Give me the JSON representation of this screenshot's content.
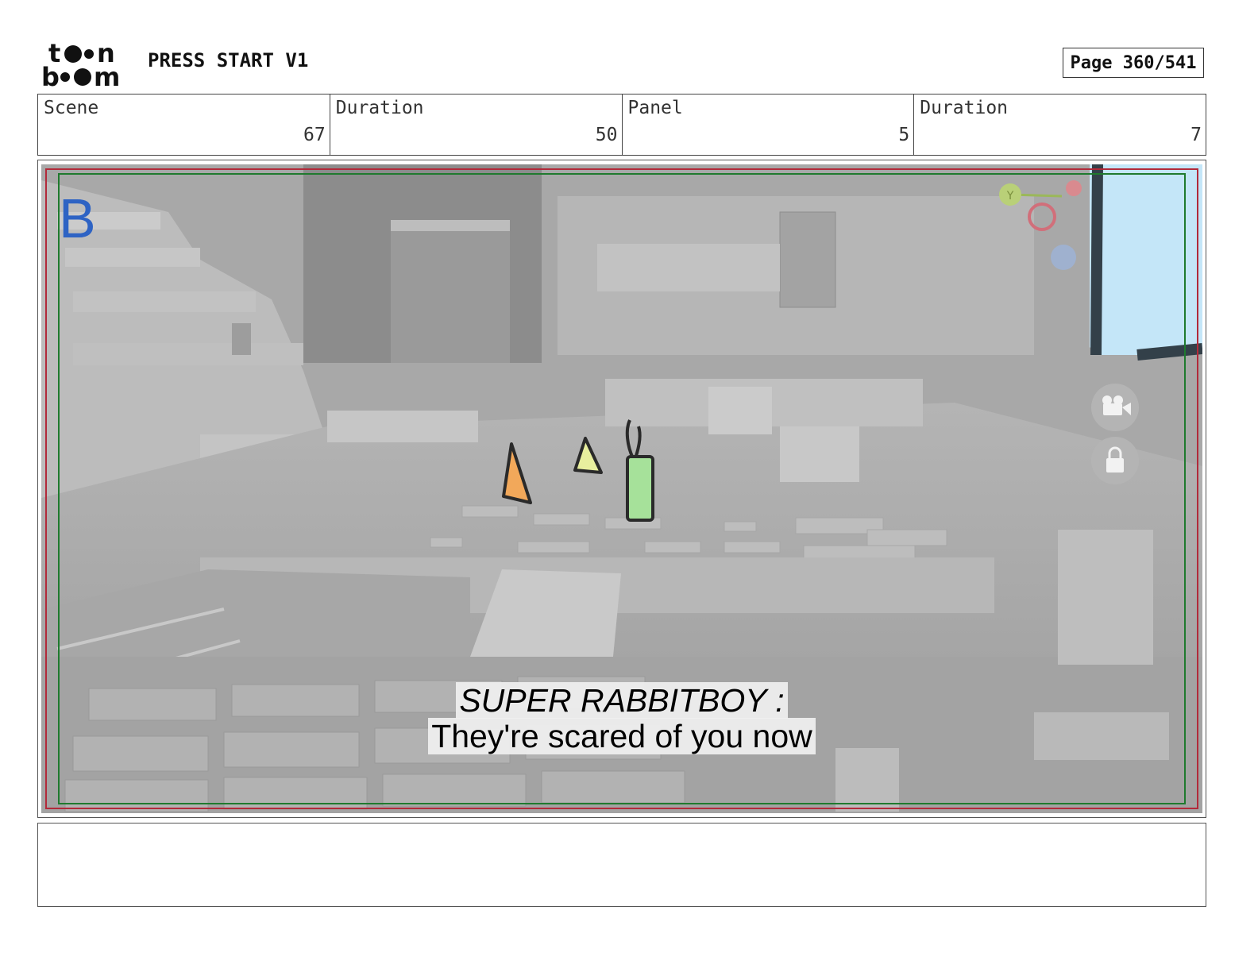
{
  "header": {
    "logo_text": "toon boom",
    "title": "PRESS START V1",
    "page_label": "Page 360/541"
  },
  "info": [
    {
      "label": "Scene",
      "value": "67"
    },
    {
      "label": "Duration",
      "value": "50"
    },
    {
      "label": "Panel",
      "value": "5"
    },
    {
      "label": "Duration",
      "value": "7"
    }
  ],
  "panel": {
    "layer_letter": "B",
    "gizmo_axis_label": "Y",
    "dialogue_speaker": "SUPER RABBITBOY :",
    "dialogue_line": "They're scared of you now",
    "colors": {
      "scene_gray": "#a9a9a9",
      "safe_frame_green": "#1f7a2e",
      "action_frame_red": "#b22a3a",
      "letter_blue": "#2e63c4",
      "sky_blue": "#c4e6f8"
    },
    "icons": [
      "camera-icon",
      "lock-icon"
    ]
  },
  "notes": {
    "text": ""
  }
}
